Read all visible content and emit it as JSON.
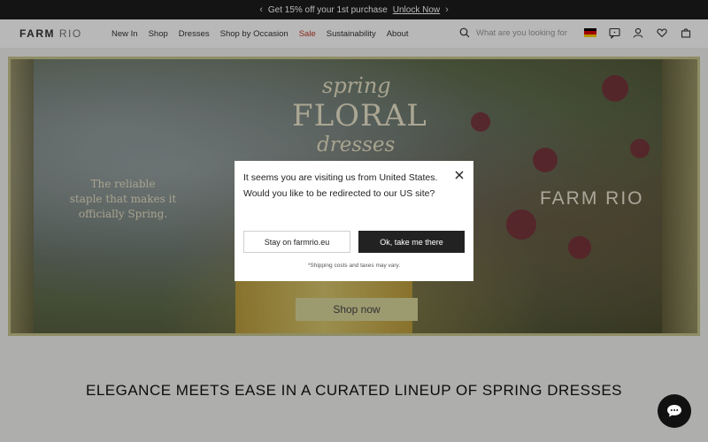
{
  "announcement": {
    "text": "Get 15% off your 1st purchase",
    "link": "Unlock Now",
    "prev": "‹",
    "next": "›"
  },
  "header": {
    "logo_bold": "FARM",
    "logo_light": "RIO",
    "nav": [
      "New In",
      "Shop",
      "Dresses",
      "Shop by Occasion",
      "Sale",
      "Sustainability",
      "About"
    ],
    "search_placeholder": "What are you looking for"
  },
  "hero": {
    "spring": "spring",
    "floral": "FLORAL",
    "dresses": "dresses",
    "tagline_1": "The reliable",
    "tagline_2": "staple that makes it",
    "tagline_3": "officially Spring.",
    "brand": "FARM RIO",
    "cta": "Shop now"
  },
  "section": {
    "title": "ELEGANCE MEETS EASE IN A CURATED LINEUP OF SPRING DRESSES"
  },
  "modal": {
    "message": "It seems you are visiting us from United States. Would you like to be redirected to our US site?",
    "stay_label": "Stay on farmrio.eu",
    "ok_label": "Ok, take me there",
    "note": "*Shipping costs and taxes may vary."
  },
  "colors": {
    "sale": "#c0392b",
    "accent_dark": "#222222",
    "cta_bg": "#d9d79c"
  }
}
